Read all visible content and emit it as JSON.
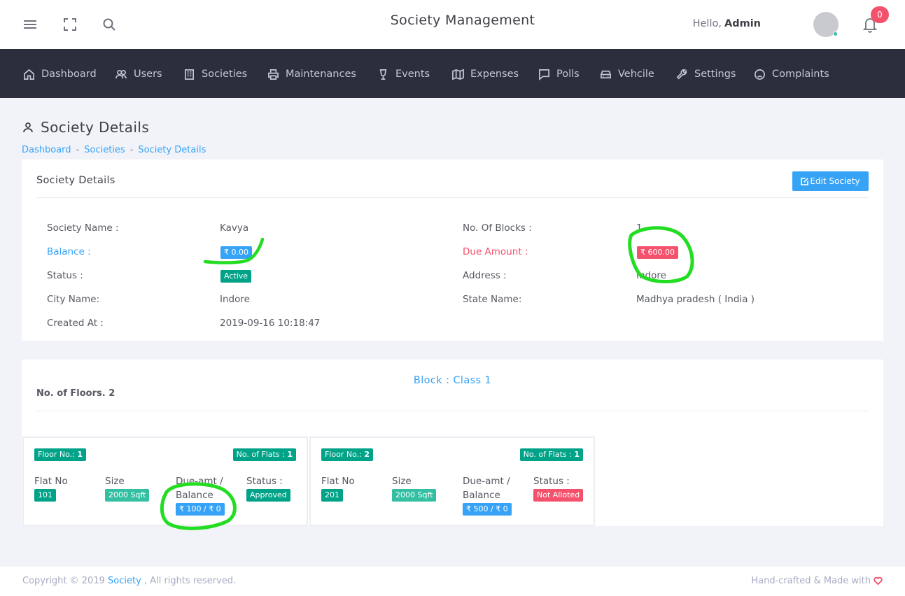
{
  "header": {
    "title": "Society Management",
    "greeting": "Hello,",
    "username": "Admin",
    "notification_count": "0"
  },
  "nav": {
    "items": [
      {
        "label": "Dashboard",
        "icon": "home-icon"
      },
      {
        "label": "Users",
        "icon": "users-icon"
      },
      {
        "label": "Societies",
        "icon": "building-icon"
      },
      {
        "label": "Maintenances",
        "icon": "printer-icon"
      },
      {
        "label": "Events",
        "icon": "glass-icon"
      },
      {
        "label": "Expenses",
        "icon": "map-icon"
      },
      {
        "label": "Polls",
        "icon": "chat-icon"
      },
      {
        "label": "Vehcile",
        "icon": "car-icon"
      },
      {
        "label": "Settings",
        "icon": "wrench-icon"
      },
      {
        "label": "Complaints",
        "icon": "sad-face-icon"
      }
    ]
  },
  "page": {
    "title": "Society Details",
    "breadcrumb": [
      "Dashboard",
      "Societies",
      "Society Details"
    ]
  },
  "details": {
    "card_title": "Society Details",
    "edit_button": "Edit Society",
    "society_name_label": "Society Name :",
    "society_name": "Kavya",
    "blocks_label": "No. Of Blocks :",
    "blocks": "1",
    "balance_label": "Balance :",
    "balance": "₹ 0.00",
    "due_label": "Due Amount :",
    "due": "₹ 600.00",
    "status_label": "Status :",
    "status": "Active",
    "address_label": "Address :",
    "address": "Indore",
    "city_label": "City Name:",
    "city": "Indore",
    "state_label": "State Name:",
    "state": "Madhya pradesh ( India )",
    "created_label": "Created At :",
    "created": "2019-09-16 10:18:47"
  },
  "block": {
    "title": "Block : Class 1",
    "floors": "No. of Floors. 2",
    "col_flat": "Flat No",
    "col_size": "Size",
    "col_due": "Due-amt / Balance",
    "col_status": "Status :",
    "floor_prefix": "Floor No.:",
    "flats_prefix": "No. of Flats :",
    "floor_list": [
      {
        "floor": "1",
        "flats": "1",
        "flat_no": "101",
        "size": "2000 Sqft",
        "due": "₹ 100 / ₹ 0",
        "status": "Approved"
      },
      {
        "floor": "2",
        "flats": "1",
        "flat_no": "201",
        "size": "2000 Sqft",
        "due": "₹ 500 / ₹ 0",
        "status": "Not Alloted"
      }
    ]
  },
  "footer": {
    "copyright": "Copyright © 2019",
    "brand": "Society",
    "rights": ", All rights reserved.",
    "made": "Hand-crafted & Made with"
  },
  "colors": {
    "accent": "#36a3f7",
    "danger": "#f4516c",
    "success": "#34bfa3",
    "nav_bg": "#2c2e3e",
    "annotation": "#22dd22"
  }
}
